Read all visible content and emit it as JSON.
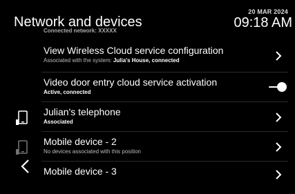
{
  "header": {
    "title": "Network and devices",
    "date": "20 MAR 2024",
    "time": "09:18 AM",
    "peek_text": "Connected network: XXXXX"
  },
  "rows": [
    {
      "label": "View Wireless Cloud service configuration",
      "sub_prefix": "Associated with the system: ",
      "sub_value": "Julia's House, connected",
      "control": "chevron-right-icon"
    },
    {
      "label": "Video door entry cloud service activation",
      "sub": "Active, connected",
      "control": "toggle-on"
    },
    {
      "label": "Julian's telephone",
      "sub": "Associated",
      "icon": "mobile-phone-icon",
      "control": "chevron-right-icon"
    },
    {
      "label": "Mobile device - 2",
      "sub": "No devices associated with this position",
      "icon": "mobile-phone-icon",
      "control": "chevron-right-icon"
    },
    {
      "label": "Mobile device - 3",
      "control": "chevron-right-icon"
    }
  ],
  "colors": {
    "background": "#000000",
    "text": "#ffffff",
    "muted": "#bbbbbb",
    "divider": "#2c2c2c"
  }
}
